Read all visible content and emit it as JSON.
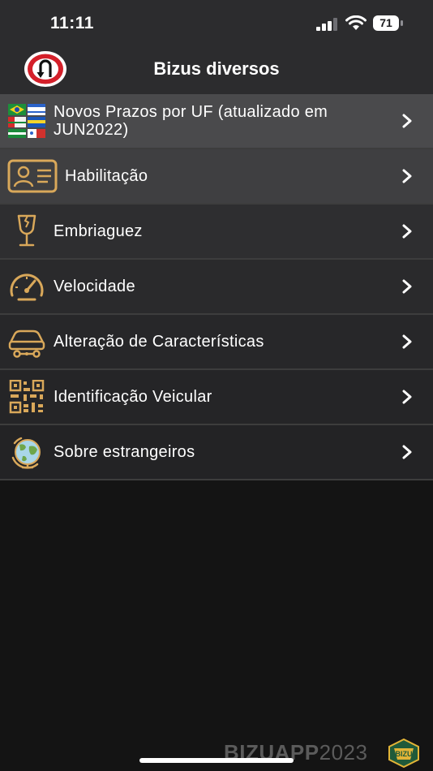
{
  "status_bar": {
    "time": "11:11",
    "battery": "71"
  },
  "header": {
    "title": "Bizus diversos",
    "back_icon": "u-turn-sign-icon"
  },
  "menu": {
    "items": [
      {
        "label_line1": "Novos Prazos por UF (atualizado em",
        "label_line2": "JUN2022)",
        "icon": "state-flags-icon",
        "bg": "#4a4a4c"
      },
      {
        "label": "Habilitação",
        "icon": "id-card-icon",
        "bg": "#3f3f41"
      },
      {
        "label": "Embriaguez",
        "icon": "broken-glass-icon",
        "bg": "#2e2e30"
      },
      {
        "label": "Velocidade",
        "icon": "speedometer-icon",
        "bg": "#2a2a2c"
      },
      {
        "label": "Alteração de Características",
        "icon": "car-modification-icon",
        "bg": "#272729"
      },
      {
        "label": "Identificação Veicular",
        "icon": "qr-code-icon",
        "bg": "#252527"
      },
      {
        "label": "Sobre estrangeiros",
        "icon": "globe-icon",
        "bg": "#232325"
      }
    ]
  },
  "footer": {
    "watermark_bold": "BIZUAPP",
    "watermark_light": "2023",
    "badge_text": "BIZU"
  },
  "colors": {
    "accent_gold": "#d9a85a",
    "header_bg": "#2c2c2e",
    "back_sign_red": "#d4202a"
  }
}
